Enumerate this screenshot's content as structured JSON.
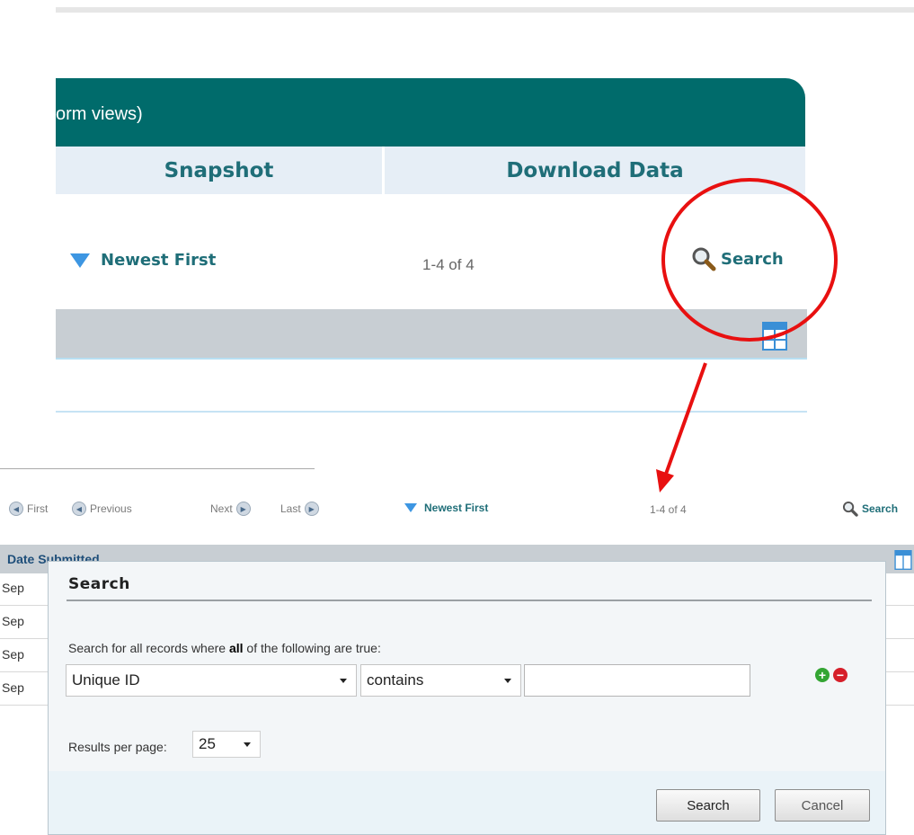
{
  "zoom_view": {
    "panel_caption": "orm views)",
    "tabs": {
      "snapshot": "Snapshot",
      "download": "Download Data"
    },
    "sort_label": "Newest First",
    "count": "1-4 of 4",
    "search_label": "Search"
  },
  "annotation": {
    "circle_color": "#e81010"
  },
  "pager": {
    "first": "First",
    "previous": "Previous",
    "next": "Next",
    "last": "Last",
    "sort_label": "Newest First",
    "count": "1-4 of 4",
    "search_label": "Search"
  },
  "table": {
    "header": "Date Submitted",
    "rows": [
      "Sep",
      "Sep",
      "Sep",
      "Sep"
    ]
  },
  "modal": {
    "title": "Search",
    "description_prefix": "Search for all records where ",
    "description_bold": "all",
    "description_suffix": " of the following are true:",
    "field_value": "Unique ID",
    "operator_value": "contains",
    "text_value": "",
    "results_label": "Results per page:",
    "results_value": "25",
    "search_button": "Search",
    "cancel_button": "Cancel"
  },
  "colors": {
    "teal": "#006b6b",
    "link": "#1f6e78",
    "accent_blue": "#3d96e2"
  }
}
